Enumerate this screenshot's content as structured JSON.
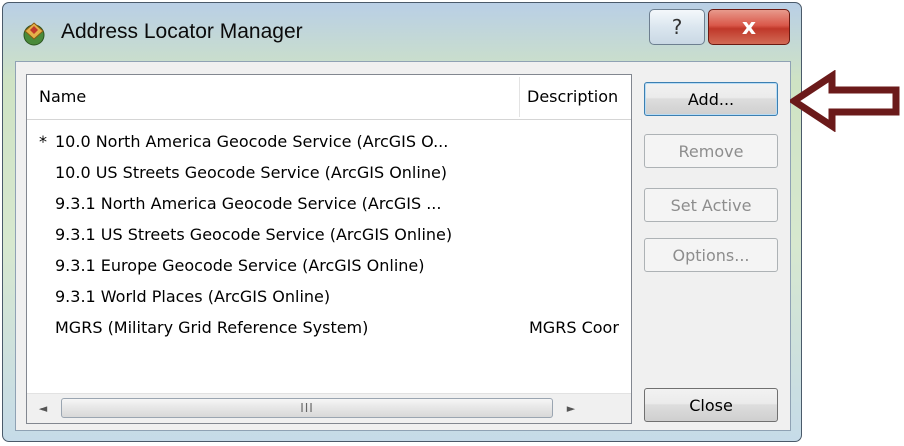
{
  "window": {
    "title": "Address Locator Manager",
    "help_glyph": "?",
    "close_glyph": "x",
    "icon": "address-locator-app-icon"
  },
  "list": {
    "columns": [
      "Name",
      "Description"
    ],
    "rows": [
      {
        "marker": "*",
        "name": "10.0 North America Geocode Service (ArcGIS O...",
        "description": ""
      },
      {
        "marker": "",
        "name": "10.0 US Streets Geocode Service (ArcGIS Online)",
        "description": ""
      },
      {
        "marker": "",
        "name": "9.3.1 North America Geocode Service (ArcGIS ...",
        "description": ""
      },
      {
        "marker": "",
        "name": "9.3.1 US Streets Geocode Service (ArcGIS Online)",
        "description": ""
      },
      {
        "marker": "",
        "name": "9.3.1 Europe Geocode Service (ArcGIS Online)",
        "description": ""
      },
      {
        "marker": "",
        "name": "9.3.1 World Places (ArcGIS Online)",
        "description": ""
      },
      {
        "marker": "",
        "name": "MGRS (Military Grid Reference System)",
        "description": "MGRS Coor"
      }
    ],
    "scrollbar": {
      "left_arrow": "◄",
      "right_arrow": "►",
      "grip": "III"
    }
  },
  "buttons": {
    "add": "Add...",
    "remove": "Remove",
    "set_active": "Set Active",
    "options": "Options...",
    "close": "Close"
  },
  "annotation": {
    "type": "pointer-arrow",
    "color": "#6b1a1a"
  }
}
